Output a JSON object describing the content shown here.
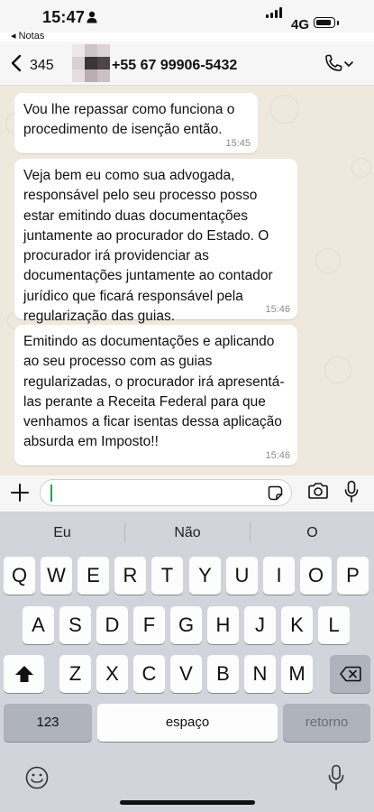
{
  "status_bar": {
    "time": "15:47",
    "back_app": "◂ Notas",
    "network": "4G"
  },
  "header": {
    "back_count": "345",
    "contact": "+55 67 99906-5432",
    "icons": [
      "chevron-left-icon",
      "avatar-blurred",
      "phone-icon",
      "chevron-down-icon"
    ]
  },
  "messages": [
    {
      "text": "Vou lhe repassar como funciona o procedimento de isenção então.",
      "time": "15:45"
    },
    {
      "text": "Veja bem eu como sua advogada, responsável pelo seu processo posso estar emitindo duas documentações juntamente ao procurador do Estado. O procurador irá providenciar as documentações juntamente ao contador jurídico que ficará responsável pela regularização das guias.",
      "time": "15:46"
    },
    {
      "text": "Emitindo as documentações e aplicando ao seu processo com as guias regularizadas, o procurador irá apresentá-las perante a Receita Federal para que venhamos a ficar isentas dessa aplicação absurda em Imposto!!",
      "time": "15:46"
    }
  ],
  "input": {
    "value": "",
    "placeholder": ""
  },
  "keyboard": {
    "suggestions": [
      "Eu",
      "Não",
      "O"
    ],
    "row1": [
      "Q",
      "W",
      "E",
      "R",
      "T",
      "Y",
      "U",
      "I",
      "O",
      "P"
    ],
    "row2": [
      "A",
      "S",
      "D",
      "F",
      "G",
      "H",
      "J",
      "K",
      "L"
    ],
    "row3": [
      "Z",
      "X",
      "C",
      "V",
      "B",
      "N",
      "M"
    ],
    "numbers_key": "123",
    "space_key": "espaço",
    "return_key": "retorno"
  },
  "colors": {
    "chat_background": "#efe8dd",
    "bubble": "#ffffff",
    "caret": "#1aa65a",
    "keyboard": "#d1d4da"
  }
}
